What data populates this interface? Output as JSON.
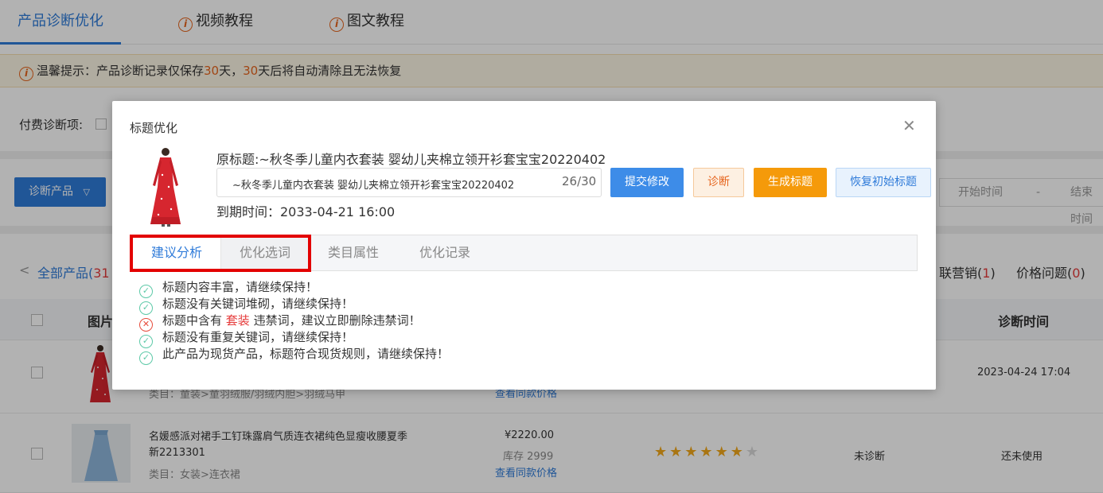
{
  "nav": {
    "tabs": [
      {
        "label": "产品诊断优化",
        "icon": ""
      },
      {
        "label": "视频教程",
        "icon": "info-icon"
      },
      {
        "label": "图文教程",
        "icon": "info-icon"
      }
    ]
  },
  "tip": {
    "prefix": "温馨提示：产品诊断记录仅保存",
    "days1": "30",
    "mid": "天，",
    "days2": "30",
    "suffix": "天后将自动清除且无法恢复"
  },
  "filter": {
    "label": "付费诊断项:"
  },
  "actions": {
    "diagnose_label": "诊断产品",
    "start_placeholder": "开始时间",
    "dash": "-",
    "end_placeholder": "结束时间"
  },
  "categories": {
    "all_label": "全部产品(",
    "all_count": "31",
    "tab_marketing_label": "联营销(",
    "tab_marketing_count": "1",
    "tab_marketing_close": ")",
    "tab_price_label": "价格问题(",
    "tab_price_count": "0",
    "tab_price_close": ")"
  },
  "table": {
    "col_image": "图片",
    "col_time": "诊断时间",
    "rows": [
      {
        "category": "类目：童装>童羽绒服/羽绒内胆>羽绒马甲",
        "same_price": "查看同款价格",
        "time": "2023-04-24 17:04"
      },
      {
        "name": "名媛感派对裙手工钉珠露肩气质连衣裙纯色显瘦收腰夏季新2213301",
        "category": "类目：女装>连衣裙",
        "price": "¥2220.00",
        "stock": "库存 2999",
        "same_price": "查看同款价格",
        "stars": 6,
        "stars_max": 7,
        "diag_status": "未诊断",
        "time": "还未使用"
      }
    ]
  },
  "modal": {
    "title": "标题优化",
    "close_icon": "close-icon",
    "original_title": "原标题:~秋冬季儿童内衣套装 婴幼儿夹棉立领开衫套宝宝20220402",
    "input_value": "~秋冬季儿童内衣套装 婴幼儿夹棉立领开衫套宝宝20220402",
    "char_count": "26/30",
    "expire": "到期时间：2033-04-21 16:00",
    "buttons": {
      "submit": "提交修改",
      "diagnose": "诊断",
      "generate": "生成标题",
      "restore": "恢复初始标题"
    },
    "tabs": [
      "建议分析",
      "优化选词",
      "类目属性",
      "优化记录"
    ],
    "results": [
      {
        "ok": true,
        "text": "标题内容丰富，请继续保持！"
      },
      {
        "ok": true,
        "text": "标题没有关键词堆砌，请继续保持！"
      },
      {
        "ok": false,
        "pre": "标题中含有 ",
        "word": "套装",
        "post": " 违禁词，建议立即删除违禁词！"
      },
      {
        "ok": true,
        "text": "标题没有重复关键词，请继续保持！"
      },
      {
        "ok": true,
        "text": "此产品为现货产品，标题符合现货规则，请继续保持！"
      }
    ]
  }
}
